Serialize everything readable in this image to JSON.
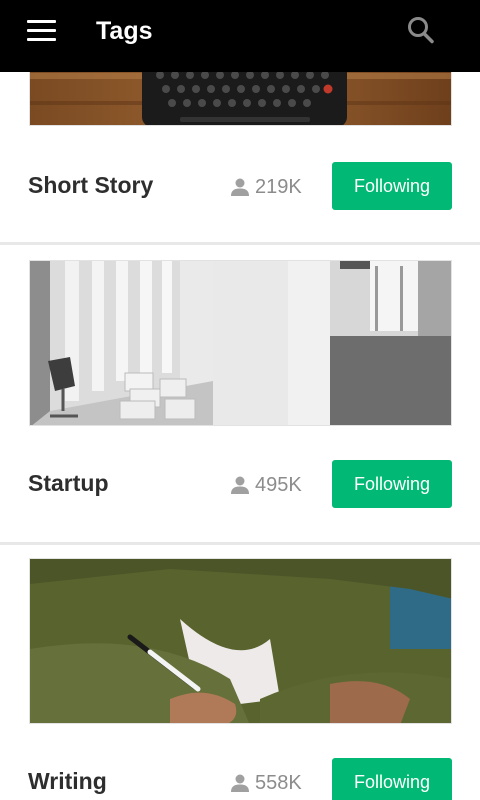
{
  "appbar": {
    "title": "Tags",
    "menu_icon": "hamburger-menu-icon",
    "search_icon": "search-icon"
  },
  "colors": {
    "appbar_bg": "#000000",
    "follow_button": "#02b875",
    "tag_text": "#2e2e2e",
    "count_text": "#8c8c8c"
  },
  "tags": [
    {
      "name": "Short Story",
      "followers": "219K",
      "button": "Following",
      "image": "typewriter-photo"
    },
    {
      "name": "Startup",
      "followers": "495K",
      "button": "Following",
      "image": "empty-office-photo"
    },
    {
      "name": "Writing",
      "followers": "558K",
      "button": "Following",
      "image": "person-writing-photo"
    }
  ]
}
